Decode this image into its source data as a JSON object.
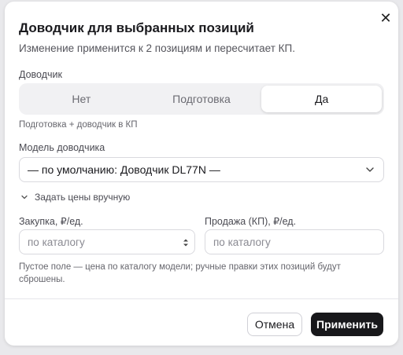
{
  "dialog": {
    "title": "Доводчик для выбранных позиций",
    "subtitle": "Изменение применится к 2 позициям и пересчитает КП.",
    "close_icon": "close-icon"
  },
  "closer": {
    "label": "Доводчик",
    "options": [
      "Нет",
      "Подготовка",
      "Да"
    ],
    "selected": "Да",
    "hint": "Подготовка + доводчик в КП"
  },
  "model": {
    "label": "Модель доводчика",
    "value": "— по умолчанию: Доводчик DL77N —"
  },
  "manual_prices": {
    "toggle_label": "Задать цены вручную",
    "purchase_label": "Закупка, ₽/ед.",
    "purchase_placeholder": "по каталогу",
    "sale_label": "Продажа (КП), ₽/ед.",
    "sale_placeholder": "по каталогу",
    "note": "Пустое поле — цена по каталогу модели; ручные правки этих позиций будут сброшены."
  },
  "footer": {
    "cancel_label": "Отмена",
    "apply_label": "Применить"
  },
  "colors": {
    "primary_button": "#18181b",
    "segment_bg": "#f1f1f3"
  }
}
